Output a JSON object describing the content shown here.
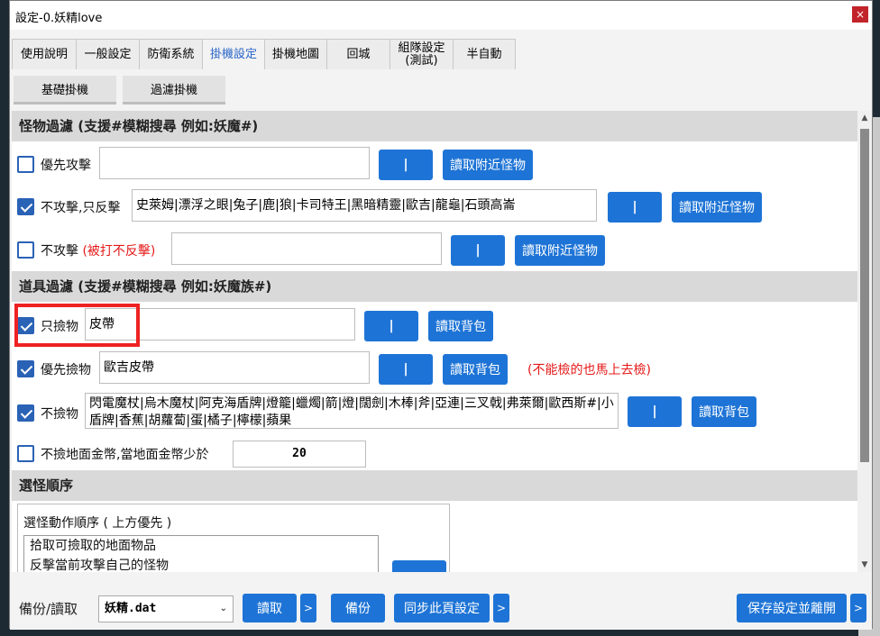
{
  "window": {
    "title": "設定-0.妖精love",
    "close_glyph": "×"
  },
  "tabs": [
    {
      "label": "使用說明"
    },
    {
      "label": "一般設定"
    },
    {
      "label": "防衛系統"
    },
    {
      "label": "掛機設定"
    },
    {
      "label": "掛機地圖"
    },
    {
      "label": "回城"
    },
    {
      "label": "組隊設定\n(測試)"
    },
    {
      "label": "半自動"
    }
  ],
  "active_tab": "掛機設定",
  "subtabs": [
    {
      "label": "基礎掛機"
    },
    {
      "label": "過濾掛機"
    }
  ],
  "monster_filter": {
    "header": "怪物過濾 (支援#模糊搜尋 例如:妖魔#)",
    "rows": [
      {
        "checked": false,
        "label": "優先攻擊",
        "value": "",
        "pipe": "|",
        "read": "讀取附近怪物"
      },
      {
        "checked": true,
        "label": "不攻擊,只反擊",
        "value": "史萊姆|漂浮之眼|兔子|鹿|狼|卡司特王|黑暗精靈|歐吉|龍龜|石頭高崙",
        "pipe": "|",
        "read": "讀取附近怪物"
      },
      {
        "checked": false,
        "label": "不攻擊",
        "label_red": "(被打不反擊)",
        "value": "",
        "pipe": "|",
        "read": "讀取附近怪物"
      }
    ]
  },
  "item_filter": {
    "header": "道具過濾 (支援#模糊搜尋 例如:妖魔族#)",
    "rows": [
      {
        "checked": true,
        "label": "只撿物",
        "value": "皮帶",
        "pipe": "|",
        "read": "讀取背包"
      },
      {
        "checked": true,
        "label": "優先撿物",
        "value": "歐吉皮帶",
        "pipe": "|",
        "read": "讀取背包",
        "note": "(不能檢的也馬上去檢)"
      },
      {
        "checked": true,
        "label": "不撿物",
        "value": "閃電魔杖|烏木魔杖|阿克海盾牌|燈籠|蠟燭|箭|燈|闊劍|木棒|斧|亞連|三叉戟|弗萊爾|歐西斯#|小盾牌|香蕉|胡蘿蔔|蛋|橘子|檸檬|蘋果",
        "pipe": "|",
        "read": "讀取背包"
      }
    ],
    "gold": {
      "checked": false,
      "label": "不撿地面金幣,當地面金幣少於",
      "value": "20"
    }
  },
  "target_order": {
    "header": "選怪順序",
    "title": "選怪動作順序 ( 上方優先 )",
    "items": [
      "拾取可撿取的地面物品",
      "反擊當前攻擊自己的怪物"
    ]
  },
  "footer": {
    "label": "備份/讀取",
    "select_value": "妖精.dat",
    "read": "讀取",
    "backup": "備份",
    "sync": "同步此頁設定",
    "save": "保存設定並離開",
    "arrow": ">"
  },
  "scrollbar": {
    "up": "▲",
    "down": "▼"
  },
  "colors": {
    "accent": "#1e74d6",
    "checkbox": "#2a62b6",
    "warning": "#e51818",
    "highlight": "#ee2222"
  }
}
